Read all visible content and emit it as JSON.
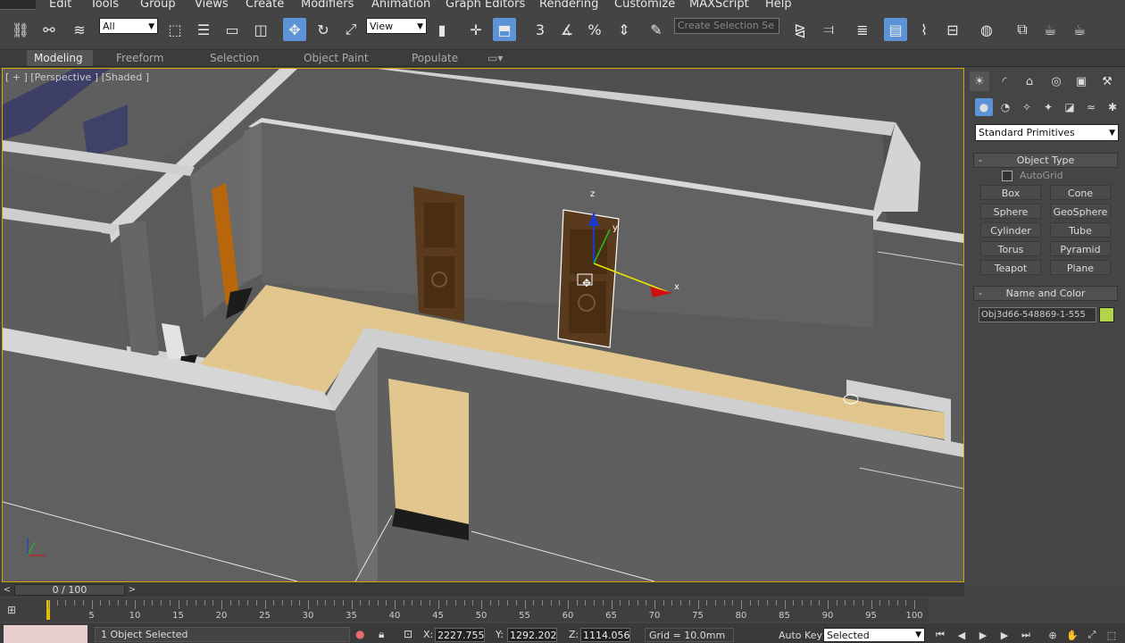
{
  "menu": [
    "Edit",
    "Tools",
    "Group",
    "Views",
    "Create",
    "Modifiers",
    "Animation",
    "Graph Editors",
    "Rendering",
    "Customize",
    "MAXScript",
    "Help"
  ],
  "toolbar": {
    "selection_filter": "All",
    "ref_coord": "View",
    "named_selection_placeholder": "Create Selection Se",
    "snap_3d_label": "3",
    "percent_snap_label": "%"
  },
  "ribbon_tabs": [
    "Modeling",
    "Freeform",
    "Selection",
    "Object Paint",
    "Populate"
  ],
  "viewport": {
    "label": "[ + ] [Perspective ] [Shaded ]",
    "axis_x": "x",
    "axis_y": "y",
    "axis_z": "z"
  },
  "command_panel": {
    "category": "Standard Primitives",
    "object_type_title": "Object Type",
    "autogrid_label": "AutoGrid",
    "primitives": [
      "Box",
      "Cone",
      "Sphere",
      "GeoSphere",
      "Cylinder",
      "Tube",
      "Torus",
      "Pyramid",
      "Teapot",
      "Plane"
    ],
    "name_color_title": "Name and Color",
    "object_name": "Obj3d66-548869-1-555",
    "object_color": "#b2d44a",
    "toggle_minus": "-"
  },
  "time_slider": {
    "frame": "0 / 100",
    "prev": "<",
    "next": ">"
  },
  "track_labels": [
    "5",
    "10",
    "15",
    "20",
    "25",
    "30",
    "35",
    "40",
    "45",
    "50",
    "55",
    "60",
    "65",
    "70",
    "75",
    "80",
    "85",
    "90",
    "95",
    "100"
  ],
  "status": {
    "selection_text": "1 Object Selected",
    "x_label": "X:",
    "x_value": "2227.755m",
    "y_label": "Y:",
    "y_value": "1292.202m",
    "z_label": "Z:",
    "z_value": "1114.056m",
    "grid": "Grid = 10.0mm",
    "auto_key": "Auto Key",
    "key_filter": "Selected"
  },
  "colors": {
    "viewport_border": "#d8a600",
    "active_button": "#5b93d6",
    "floor": "#e1c78d",
    "door": "#5a3a1c"
  }
}
